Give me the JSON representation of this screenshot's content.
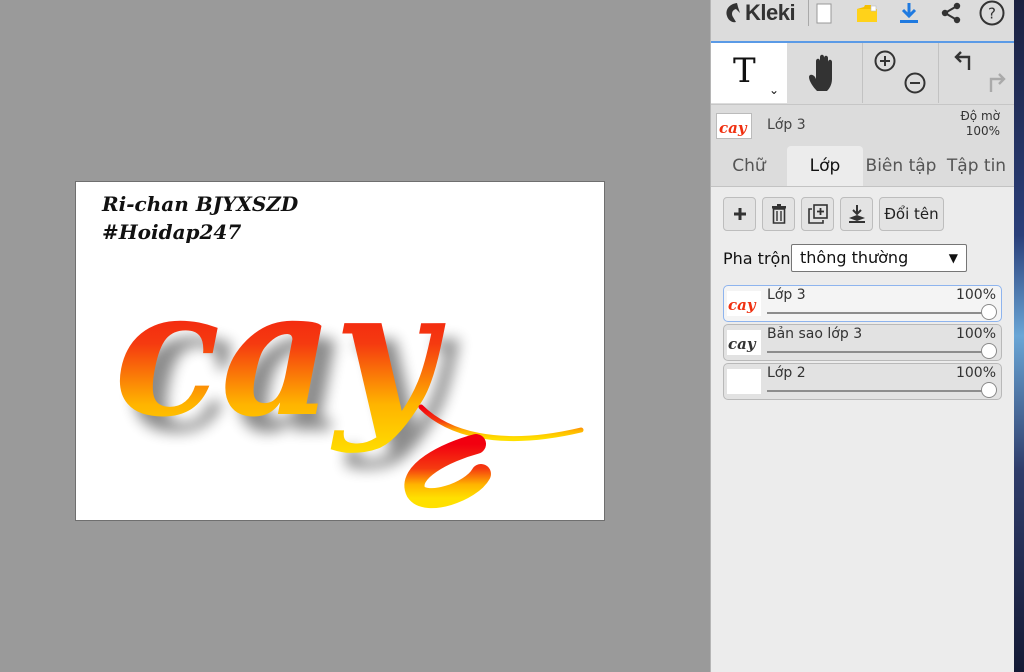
{
  "app": {
    "name": "Kleki"
  },
  "canvas": {
    "text_line1": "Ri-chan BJYXSZD",
    "text_line2": "#Hoidap247",
    "art_word": "cay",
    "gradient_top": "#f20010",
    "gradient_bottom": "#ffe000"
  },
  "toolbar": {
    "icons": [
      "new-file-icon",
      "folder-icon",
      "download-icon",
      "share-icon",
      "help-icon"
    ],
    "help_label": "?",
    "accent": "#1f7ae0"
  },
  "tools": {
    "text_tool_label": "T",
    "chevron": "⌄"
  },
  "current_layer": {
    "name": "Lớp 3",
    "opacity_label": "Độ mờ",
    "opacity_value": "100%"
  },
  "tabs": [
    {
      "label": "Chữ"
    },
    {
      "label": "Lớp"
    },
    {
      "label": "Biên tập"
    },
    {
      "label": "Tập tin"
    }
  ],
  "layer_panel": {
    "rename_label": "Đổi tên",
    "blend_label": "Pha trộn",
    "blend_value": "thông thường",
    "layers": [
      {
        "name": "Lớp 3",
        "opacity": "100%"
      },
      {
        "name": "Bản sao lớp 3",
        "opacity": "100%"
      },
      {
        "name": "Lớp 2",
        "opacity": "100%"
      }
    ]
  }
}
